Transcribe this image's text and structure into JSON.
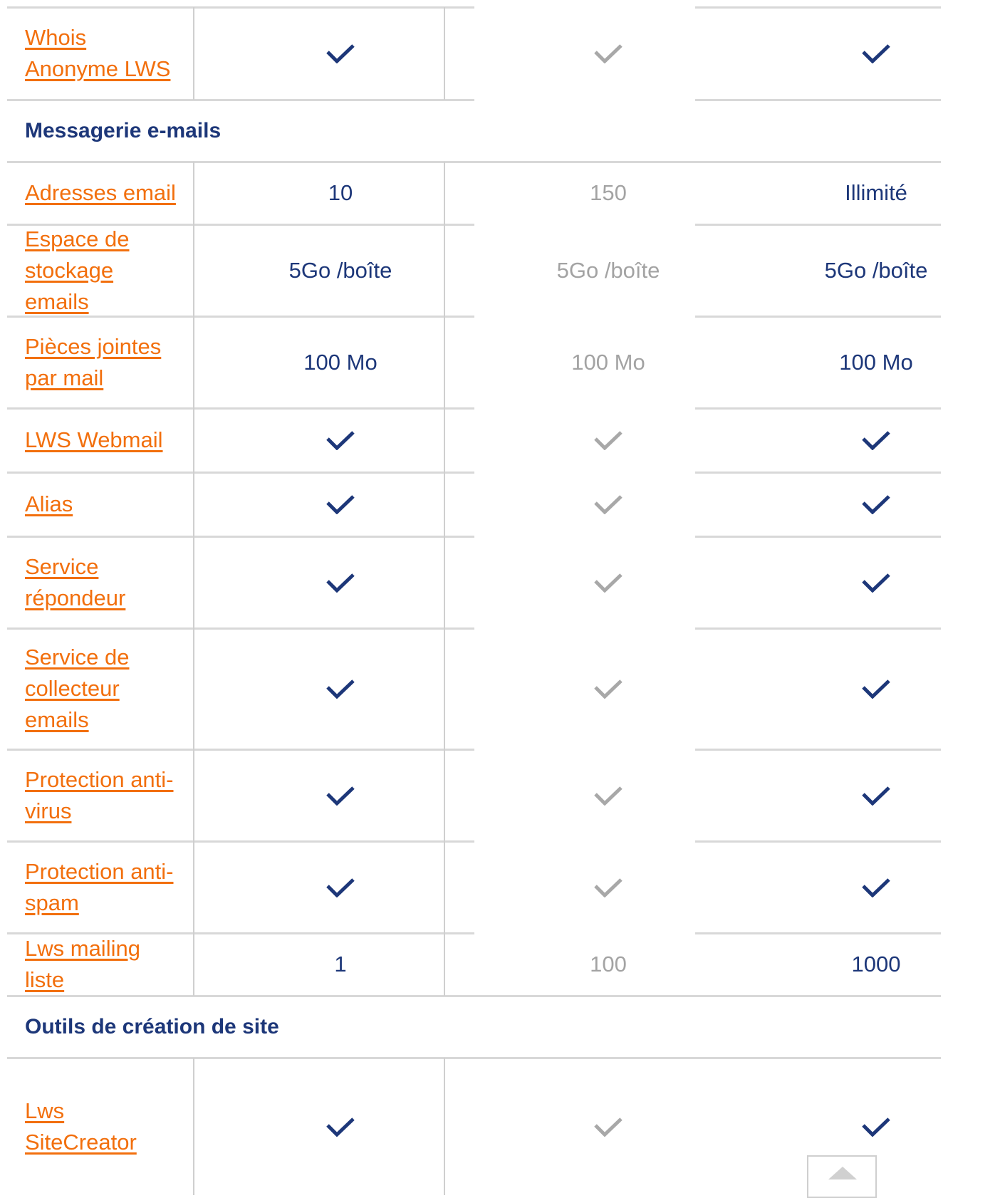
{
  "rows": [
    {
      "label": "Whois Anonyme LWS ",
      "basic": "check",
      "standard": "check",
      "pro": "check"
    },
    {
      "section": "Messagerie e-mails"
    },
    {
      "label": "Adresses email",
      "basic": "10",
      "standard": "150",
      "pro": "Illimité"
    },
    {
      "label": "Espace de stockage emails",
      "basic": "5Go /boîte",
      "standard": "5Go /boîte",
      "pro": "5Go /boîte"
    },
    {
      "label": "Pièces jointes par mail",
      "basic": "100 Mo",
      "standard": "100 Mo",
      "pro": "100 Mo"
    },
    {
      "label": "LWS Webmail",
      "basic": "check",
      "standard": "check",
      "pro": "check"
    },
    {
      "label": "Alias",
      "basic": "check",
      "standard": "check",
      "pro": "check"
    },
    {
      "label": "Service répondeur",
      "basic": "check",
      "standard": "check",
      "pro": "check"
    },
    {
      "label": "Service de collecteur emails",
      "basic": "check",
      "standard": "check",
      "pro": "check"
    },
    {
      "label": "Protection anti-virus",
      "basic": "check",
      "standard": "check",
      "pro": "check"
    },
    {
      "label": "Protection anti-spam",
      "basic": "check",
      "standard": "check",
      "pro": "check"
    },
    {
      "label": "Lws mailing liste",
      "basic": "1",
      "standard": "100",
      "pro": "1000"
    },
    {
      "section": "Outils de création de site"
    },
    {
      "label": "Lws SiteCreator",
      "basic": "check",
      "standard": "check",
      "pro": "check"
    }
  ],
  "colors": {
    "dark_blue": "#1d3779",
    "grey": "#a3a3a3",
    "orange_link": "#f26f0d"
  },
  "icons": {
    "check": "check-icon",
    "back_to_top": "arrow-up-icon"
  }
}
